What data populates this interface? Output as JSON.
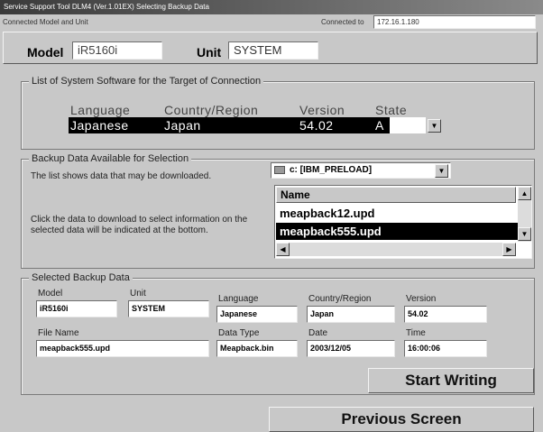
{
  "window": {
    "title": "Service Support Tool DLM4 (Ver.1.01EX) Selecting Backup Data"
  },
  "connection": {
    "heading": "Connected Model and Unit",
    "connected_to_label": "Connected to",
    "connected_to_value": "172.16.1.180",
    "model_label": "Model",
    "model_value": "iR5160i",
    "unit_label": "Unit",
    "unit_value": "SYSTEM"
  },
  "system_software": {
    "title": "List of System Software for the Target of Connection",
    "columns": [
      "Language",
      "Country/Region",
      "Version",
      "State"
    ],
    "row": {
      "language": "Japanese",
      "country": "Japan",
      "version": "54.02",
      "state": "A"
    }
  },
  "backup": {
    "title": "Backup Data Available for Selection",
    "description1": "The list shows data that may be downloaded.",
    "description2": "Click the data to download to select information on the selected data will be indicated at the bottom.",
    "drive_value": "c: [IBM_PRELOAD]",
    "list_header": "Name",
    "files": [
      "meapback12.upd",
      "meapback555.upd"
    ]
  },
  "selected": {
    "title": "Selected Backup Data",
    "model_label": "Model",
    "model_value": "iR5160i",
    "unit_label": "Unit",
    "unit_value": "SYSTEM",
    "language_label": "Language",
    "language_value": "Japanese",
    "country_label": "Country/Region",
    "country_value": "Japan",
    "version_label": "Version",
    "version_value": "54.02",
    "filename_label": "File Name",
    "filename_value": "meapback555.upd",
    "datatype_label": "Data Type",
    "datatype_value": "Meapback.bin",
    "date_label": "Date",
    "date_value": "2003/12/05",
    "time_label": "Time",
    "time_value": "16:00:06"
  },
  "buttons": {
    "start_writing": "Start Writing",
    "previous_screen": "Previous Screen"
  }
}
